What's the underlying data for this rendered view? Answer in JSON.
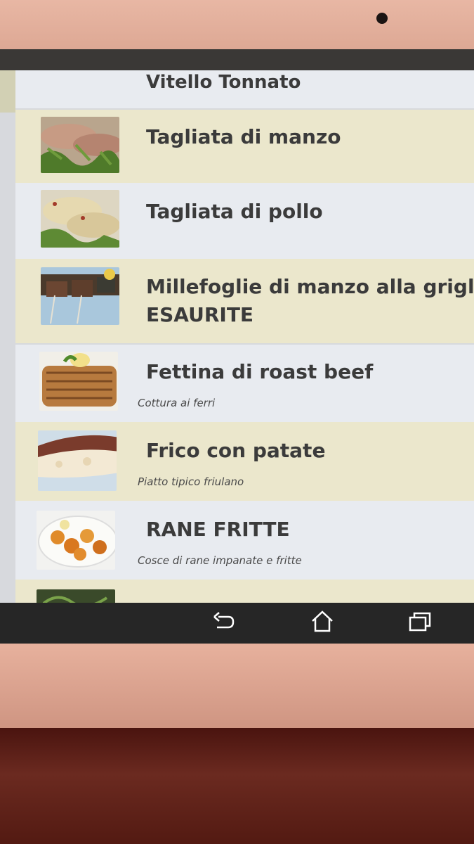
{
  "menu": {
    "items": [
      {
        "title": "Vitello Tonnato",
        "subtitle": ""
      },
      {
        "title": "Tagliata di manzo",
        "subtitle": ""
      },
      {
        "title": "Tagliata di pollo",
        "subtitle": ""
      },
      {
        "title": "Millefoglie di manzo alla griglia",
        "title2": "ESAURITE",
        "subtitle": ""
      },
      {
        "title": "Fettina di roast beef",
        "subtitle": "Cottura ai ferri"
      },
      {
        "title": "Frico con patate",
        "subtitle": "Piatto tipico friulano"
      },
      {
        "title": "RANE FRITTE",
        "subtitle": "Cosce di rane impanate e fritte"
      }
    ]
  },
  "navbar": {
    "buttons": [
      "back-icon",
      "home-icon",
      "recent-apps-icon"
    ]
  },
  "colors": {
    "row_cream": "#ebe7cc",
    "row_white": "#e8ebf0",
    "text": "#3b3b3b",
    "navbar": "#262626"
  }
}
